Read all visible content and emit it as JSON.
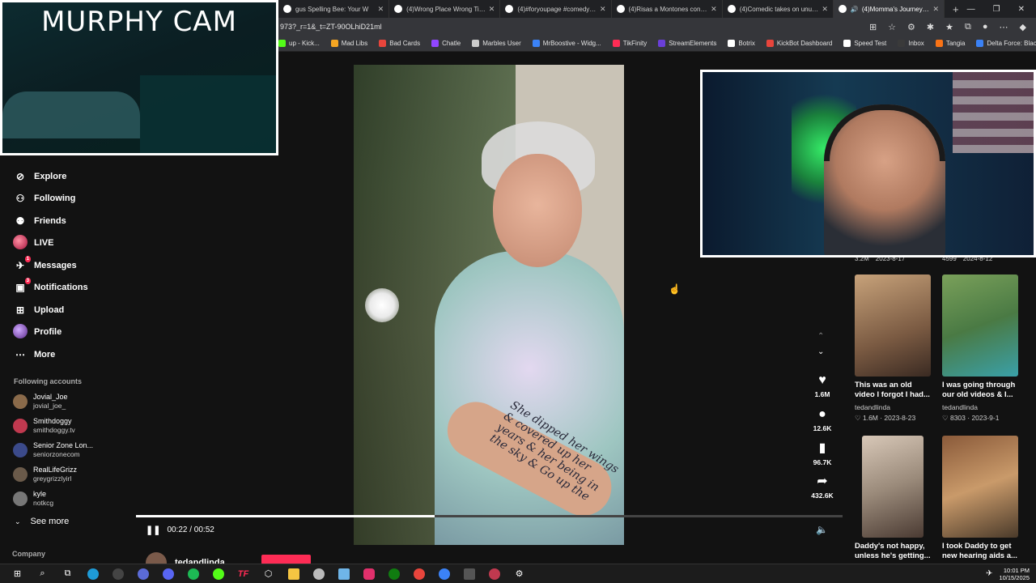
{
  "tabs": [
    {
      "label": "gus Spelling Bee: Your W",
      "icon_color": "#ffffff"
    },
    {
      "label": "(4)Wrong Place Wrong Time: A",
      "icon_color": "#ffffff"
    },
    {
      "label": "(4)#foryoupage #comedy | pe",
      "icon_color": "#ffffff"
    },
    {
      "label": "(4)Risas a Montones con Joe S",
      "icon_color": "#ffffff"
    },
    {
      "label": "(4)Comedic takes on unusual c",
      "icon_color": "#ffffff"
    },
    {
      "label": "(4)Momma's Journey Aft",
      "icon_color": "#ffffff",
      "active": true
    }
  ],
  "address": "973?_r=1&_t=ZT-90OLhiD21ml",
  "bookmarks": [
    {
      "label": "up - Kick...",
      "color": "#53fc18"
    },
    {
      "label": "Mad Libs",
      "color": "#f5a623"
    },
    {
      "label": "Bad Cards",
      "color": "#e8453c"
    },
    {
      "label": "Chatle",
      "color": "#9146ff"
    },
    {
      "label": "Marbles User",
      "color": "#cccccc"
    },
    {
      "label": "MrBoostive - Widg...",
      "color": "#3b82f6"
    },
    {
      "label": "TikFinity",
      "color": "#fe2c55"
    },
    {
      "label": "StreamElements",
      "color": "#6a3fd9"
    },
    {
      "label": "Botrix",
      "color": "#ffffff"
    },
    {
      "label": "KickBot Dashboard",
      "color": "#e8453c"
    },
    {
      "label": "Speed Test",
      "color": "#ffffff"
    },
    {
      "label": "Inbox",
      "color": "#3a3a3a"
    },
    {
      "label": "Tangia",
      "color": "#f97316"
    },
    {
      "label": "Delta Force: Black Si...",
      "color": "#3b82f6"
    }
  ],
  "murphy_cam": {
    "title": "MURPHY CAM"
  },
  "sidebar": {
    "items": [
      {
        "label": "Explore",
        "icon": "compass-icon"
      },
      {
        "label": "Following",
        "icon": "person-follow-icon"
      },
      {
        "label": "Friends",
        "icon": "friends-icon"
      },
      {
        "label": "LIVE",
        "icon": "live-icon"
      },
      {
        "label": "Messages",
        "icon": "messages-icon",
        "badge": "1"
      },
      {
        "label": "Notifications",
        "icon": "notifications-icon",
        "badge": "3"
      },
      {
        "label": "Upload",
        "icon": "upload-icon"
      },
      {
        "label": "Profile",
        "icon": "profile-icon"
      },
      {
        "label": "More",
        "icon": "more-icon"
      }
    ],
    "following_title": "Following accounts",
    "accounts": [
      {
        "name": "Jovial_Joe",
        "handle": "jovial_joe_",
        "color": "#8a6a4a"
      },
      {
        "name": "Smithdoggy",
        "handle": "smithdoggy.tv",
        "color": "#c0394f"
      },
      {
        "name": "Senior Zone Lon...",
        "handle": "seniorzonecom",
        "color": "#3b4a8a"
      },
      {
        "name": "RealLifeGrizz",
        "handle": "greygrizzlyirl",
        "color": "#6a5a4a"
      },
      {
        "name": "kyle",
        "handle": "notkcg",
        "color": "#777777"
      }
    ],
    "see_more": "See more",
    "company": "Company"
  },
  "video": {
    "tattoo": "She dipped her wings & covered up her years & her being in the sky & Go up the",
    "progress": 0.4231,
    "time": "00:22 / 00:52",
    "author": "tedandlinda"
  },
  "actions": [
    {
      "icon": "heart-icon",
      "count": "1.6M"
    },
    {
      "icon": "comment-icon",
      "count": "12.6K"
    },
    {
      "icon": "bookmark-icon",
      "count": "96.7K"
    },
    {
      "icon": "share-icon",
      "count": "432.6K"
    }
  ],
  "rec_top_stats": {
    "left": [
      "3.2M",
      "2023-8-17"
    ],
    "right": [
      "4599",
      "2024-8-12"
    ]
  },
  "recommended": [
    {
      "title": "This was an old video I forgot I had...",
      "author": "tedandlinda",
      "meta": "♡ 1.6M · 2023-8-23",
      "thumb": "linear-gradient(160deg,#c7a27a,#7a5a42 60%,#3a2a22)"
    },
    {
      "title": "I was going through our old videos & I...",
      "author": "tedandlinda",
      "meta": "♡ 8303 · 2023-9-1",
      "thumb": "linear-gradient(160deg,#7aa05a,#4a7a44 50%,#3aa0a8)"
    },
    {
      "title": "Daddy's not happy, unless he's getting...",
      "author": "",
      "meta": "",
      "thumb": "linear-gradient(160deg,#d8c8b8,#9a8a7a 50%,#4a3a32)"
    },
    {
      "title": "I took Daddy to get new hearing aids a...",
      "author": "",
      "meta": "",
      "thumb": "linear-gradient(160deg,#8a5a3a,#c99a6a 50%,#4a3a2a)"
    }
  ],
  "clock": {
    "time": "10:01 PM",
    "date": "10/15/2025"
  }
}
